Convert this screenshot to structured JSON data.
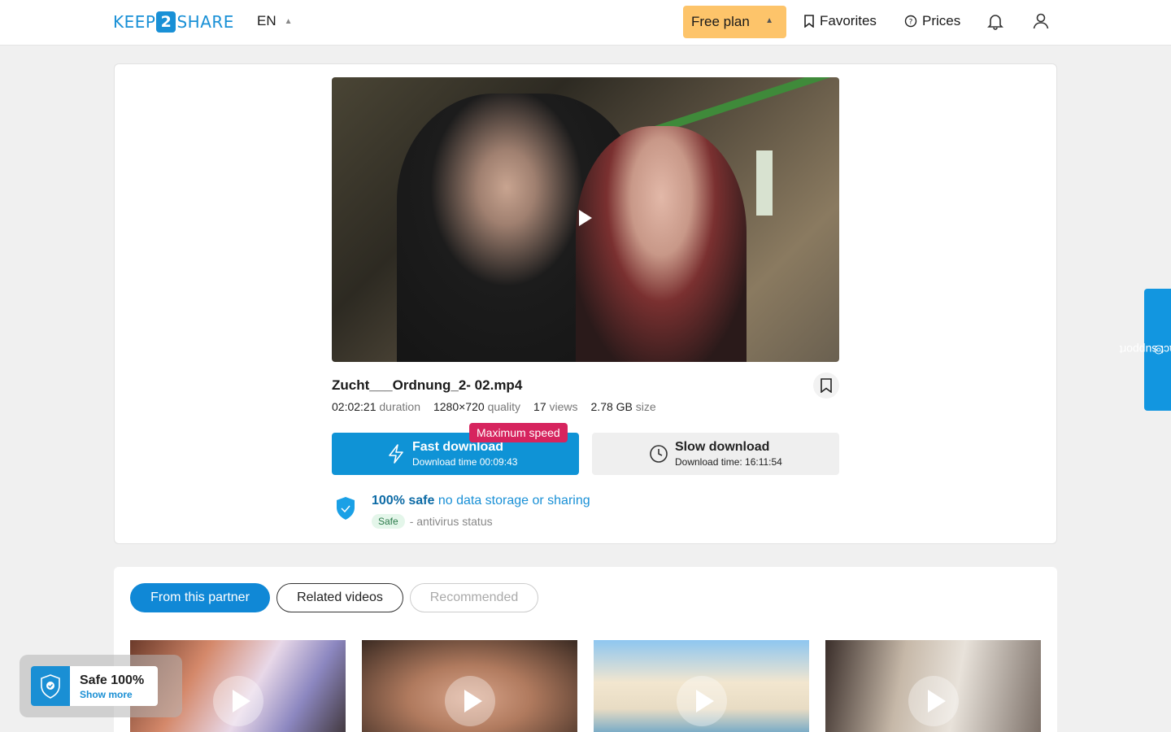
{
  "header": {
    "logo_pre": "KEEP",
    "logo_num": "2",
    "logo_post": "SHARE",
    "lang": "EN",
    "plan": "Free plan",
    "favorites": "Favorites",
    "prices": "Prices"
  },
  "file": {
    "title": "Zucht___Ordnung_2- 02.mp4",
    "duration": "02:02:21",
    "duration_label": "duration",
    "quality": "1280×720",
    "quality_label": "quality",
    "views": "17",
    "views_label": "views",
    "size": "2.78 GB",
    "size_label": "size"
  },
  "download": {
    "max_speed": "Maximum speed",
    "fast_label": "Fast download",
    "fast_time": "Download time 00:09:43",
    "slow_label": "Slow download",
    "slow_time": "Download time: 16:11:54"
  },
  "safety": {
    "safe_bold": "100% safe",
    "safe_text": "no data storage or sharing",
    "pill": "Safe",
    "status": "- antivirus status"
  },
  "support": "contact support",
  "tabs": [
    "From this partner",
    "Related videos",
    "Recommended"
  ],
  "popup": {
    "title": "Safe 100%",
    "link": "Show more"
  },
  "colors": {
    "accent": "#0f93d6",
    "plan": "#fdc46a",
    "badge": "#d6245e"
  }
}
